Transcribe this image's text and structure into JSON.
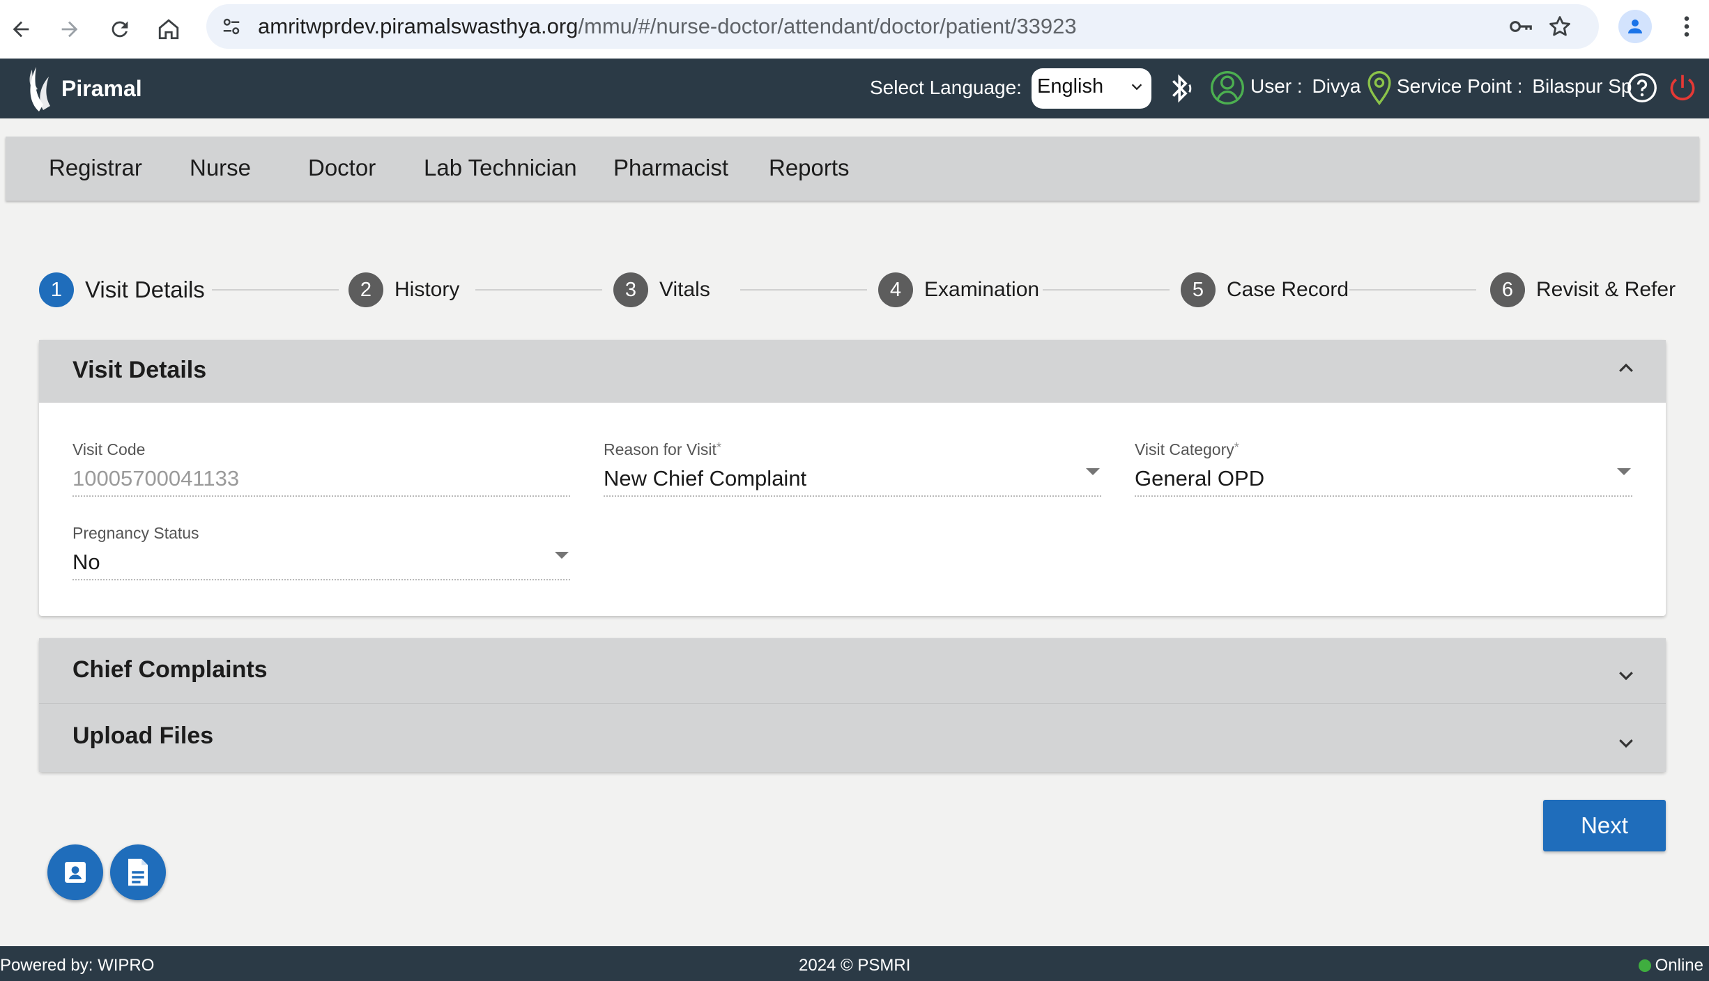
{
  "browser": {
    "url_host": "amritwprdev.piramalswasthya.org",
    "url_path": "/mmu/#/nurse-doctor/attendant/doctor/patient/33923"
  },
  "header": {
    "logo_text": "Piramal",
    "language_label": "Select Language:",
    "language_value": "English",
    "user_label": "User :",
    "user_name": "Divya",
    "service_point_label": "Service Point :",
    "service_point_value": "Bilaspur Sp"
  },
  "role_nav": [
    "Registrar",
    "Nurse",
    "Doctor",
    "Lab Technician",
    "Pharmacist",
    "Reports"
  ],
  "stepper": [
    {
      "num": "1",
      "label": "Visit Details",
      "active": true
    },
    {
      "num": "2",
      "label": "History",
      "active": false
    },
    {
      "num": "3",
      "label": "Vitals",
      "active": false
    },
    {
      "num": "4",
      "label": "Examination",
      "active": false
    },
    {
      "num": "5",
      "label": "Case Record",
      "active": false
    },
    {
      "num": "6",
      "label": "Revisit & Refer",
      "active": false
    }
  ],
  "visit_details": {
    "title": "Visit Details",
    "fields": [
      {
        "label": "Visit Code",
        "required": false,
        "value": "10005700041133",
        "type": "readonly"
      },
      {
        "label": "Reason for Visit",
        "required": true,
        "value": "New Chief Complaint",
        "type": "select"
      },
      {
        "label": "Visit Category",
        "required": true,
        "value": "General OPD",
        "type": "select"
      },
      {
        "label": "Pregnancy Status",
        "required": false,
        "value": "No",
        "type": "select"
      }
    ]
  },
  "chief_complaints": {
    "title": "Chief Complaints"
  },
  "upload_files": {
    "title": "Upload Files"
  },
  "actions": {
    "next_label": "Next"
  },
  "footer": {
    "powered_by": "Powered by: WIPRO",
    "copyright": "2024 © PSMRI",
    "status": "Online"
  },
  "colors": {
    "primary": "#1f6dbb",
    "header_bg": "#2b3a46",
    "nav_bg": "#d2d3d4",
    "online": "#3fae3f",
    "power": "#e53935",
    "user_icon": "#4caf50",
    "location_icon": "#8bc34a"
  }
}
